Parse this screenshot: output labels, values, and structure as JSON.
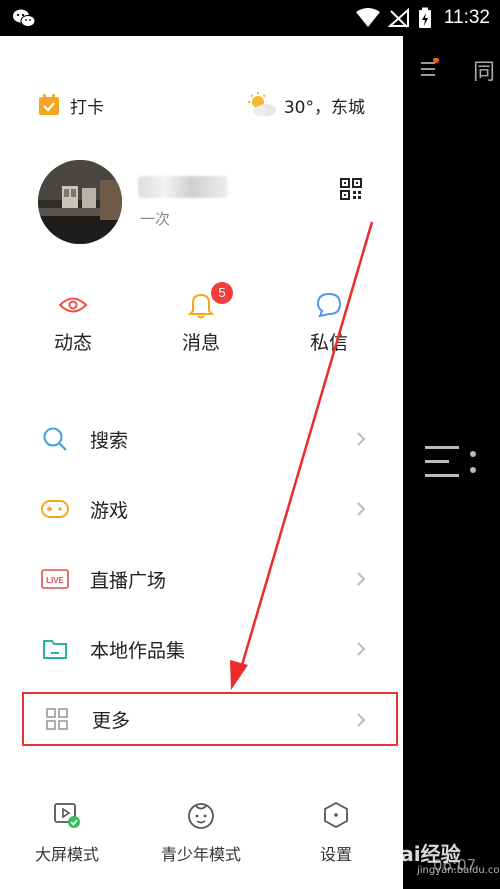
{
  "status_bar": {
    "time": "11:32"
  },
  "behind_panel": {
    "label": "同",
    "time": "06:07"
  },
  "drawer": {
    "checkin_label": "打卡",
    "weather": "30°，东城",
    "profile": {
      "subtext": "一次"
    },
    "quick_actions": [
      {
        "label": "动态"
      },
      {
        "label": "消息",
        "badge": "5"
      },
      {
        "label": "私信"
      }
    ],
    "menu": [
      {
        "label": "搜索",
        "icon": "search-icon"
      },
      {
        "label": "游戏",
        "icon": "gamepad-icon"
      },
      {
        "label": "直播广场",
        "icon": "live-icon",
        "icon_text": "LIVE"
      },
      {
        "label": "本地作品集",
        "icon": "folder-icon"
      },
      {
        "label": "更多",
        "icon": "grid-icon"
      }
    ],
    "bottom_bar": [
      {
        "label": "大屏模式",
        "icon": "tv-mode-icon"
      },
      {
        "label": "青少年模式",
        "icon": "teen-mode-icon"
      },
      {
        "label": "设置",
        "icon": "settings-icon"
      }
    ]
  },
  "watermark": {
    "text": "Bai经验",
    "sub": "jingyan.baidu.com"
  },
  "colors": {
    "accent_orange": "#f5a623",
    "badge_red": "#f23d3d",
    "highlight_red": "#e53232"
  }
}
